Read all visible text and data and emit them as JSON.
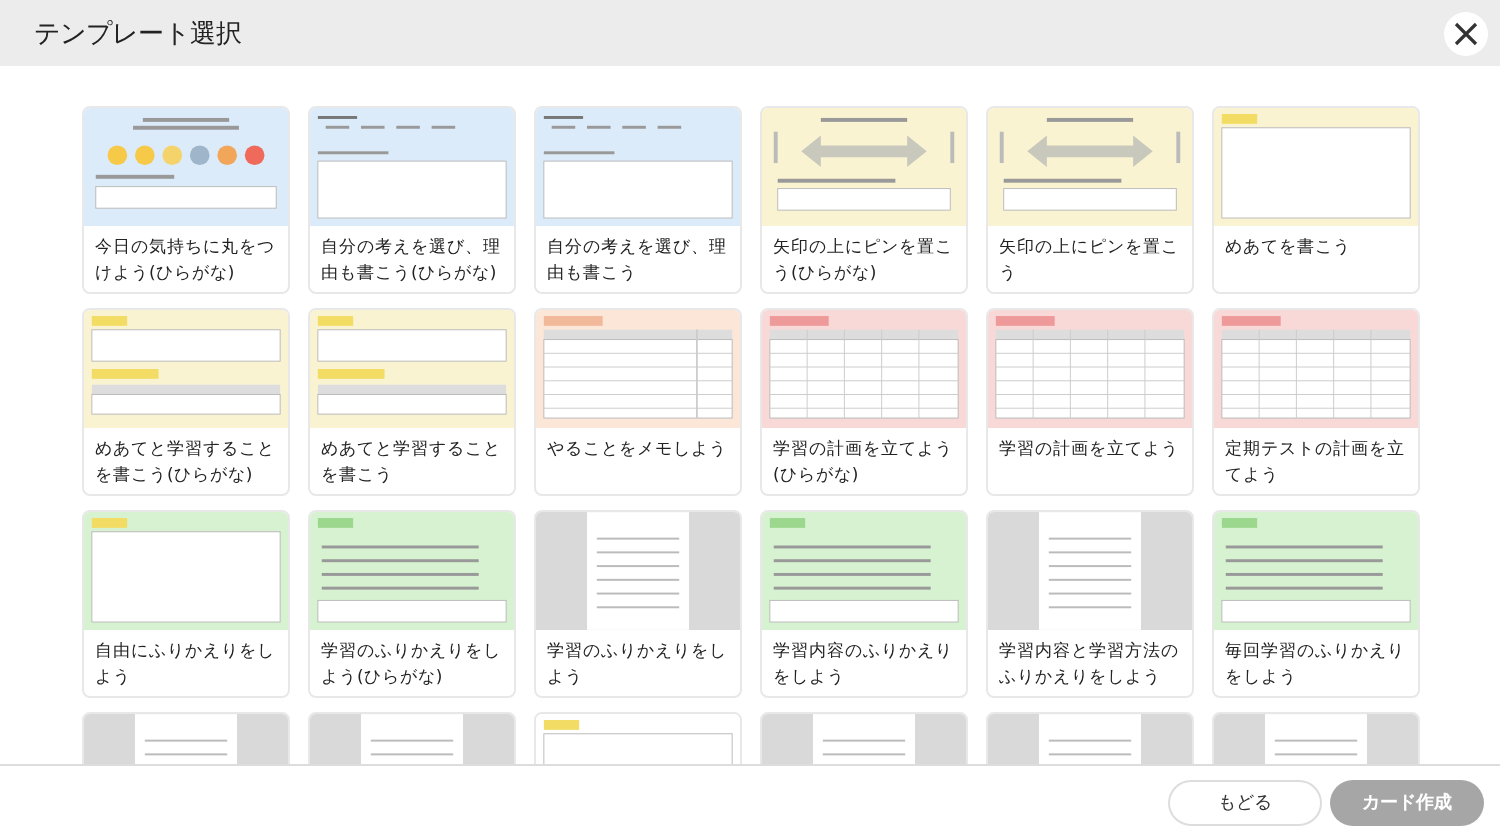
{
  "window": {
    "title": "テンプレート選択"
  },
  "cards": [
    {
      "label": "今日の気持ちに丸をつけよう(ひらがな)",
      "kind": "emoji",
      "color": "#dcebfa"
    },
    {
      "label": "自分の考えを選び、理由も書こう(ひらがな)",
      "kind": "choice",
      "color": "#dcebfa"
    },
    {
      "label": "自分の考えを選び、理由も書こう",
      "kind": "choice",
      "color": "#dcebfa"
    },
    {
      "label": "矢印の上にピンを置こう(ひらがな)",
      "kind": "arrow",
      "color": "#faf3d2"
    },
    {
      "label": "矢印の上にピンを置こう",
      "kind": "arrow",
      "color": "#faf3d2"
    },
    {
      "label": "めあてを書こう",
      "kind": "box",
      "color": "#faf3d2"
    },
    {
      "label": "めあてと学習することを書こう(ひらがな)",
      "kind": "goal",
      "color": "#faf3d2"
    },
    {
      "label": "めあてと学習することを書こう",
      "kind": "goal",
      "color": "#faf3d2"
    },
    {
      "label": "やることをメモしよう",
      "kind": "memo",
      "color": "#fbe6d8"
    },
    {
      "label": "学習の計画を立てよう(ひらがな)",
      "kind": "table",
      "color": "#f9d8d8"
    },
    {
      "label": "学習の計画を立てよう",
      "kind": "table",
      "color": "#f9d8d8"
    },
    {
      "label": "定期テストの計画を立てよう",
      "kind": "table",
      "color": "#f9d8d8"
    },
    {
      "label": "自由にふりかえりをしよう",
      "kind": "box",
      "color": "#d6f2d0"
    },
    {
      "label": "学習のふりかえりをしよう(ひらがな)",
      "kind": "review",
      "color": "#d6f2d0"
    },
    {
      "label": "学習のふりかえりをしよう",
      "kind": "page",
      "color": "#d9d9d9"
    },
    {
      "label": "学習内容のふりかえりをしよう",
      "kind": "review",
      "color": "#d6f2d0"
    },
    {
      "label": "学習内容と学習方法のふりかえりをしよう",
      "kind": "page",
      "color": "#d9d9d9"
    },
    {
      "label": "毎回学習のふりかえりをしよう",
      "kind": "review",
      "color": "#d6f2d0"
    },
    {
      "kind": "page",
      "color": "#d9d9d9"
    },
    {
      "kind": "page",
      "color": "#d9d9d9"
    },
    {
      "kind": "box",
      "color": "#ffffff"
    },
    {
      "kind": "page",
      "color": "#d9d9d9"
    },
    {
      "kind": "page",
      "color": "#d9d9d9"
    },
    {
      "kind": "page",
      "color": "#d9d9d9"
    }
  ],
  "buttons": [
    {
      "label": "もどる",
      "disabled": false
    },
    {
      "label": "カード作成",
      "disabled": true
    }
  ]
}
